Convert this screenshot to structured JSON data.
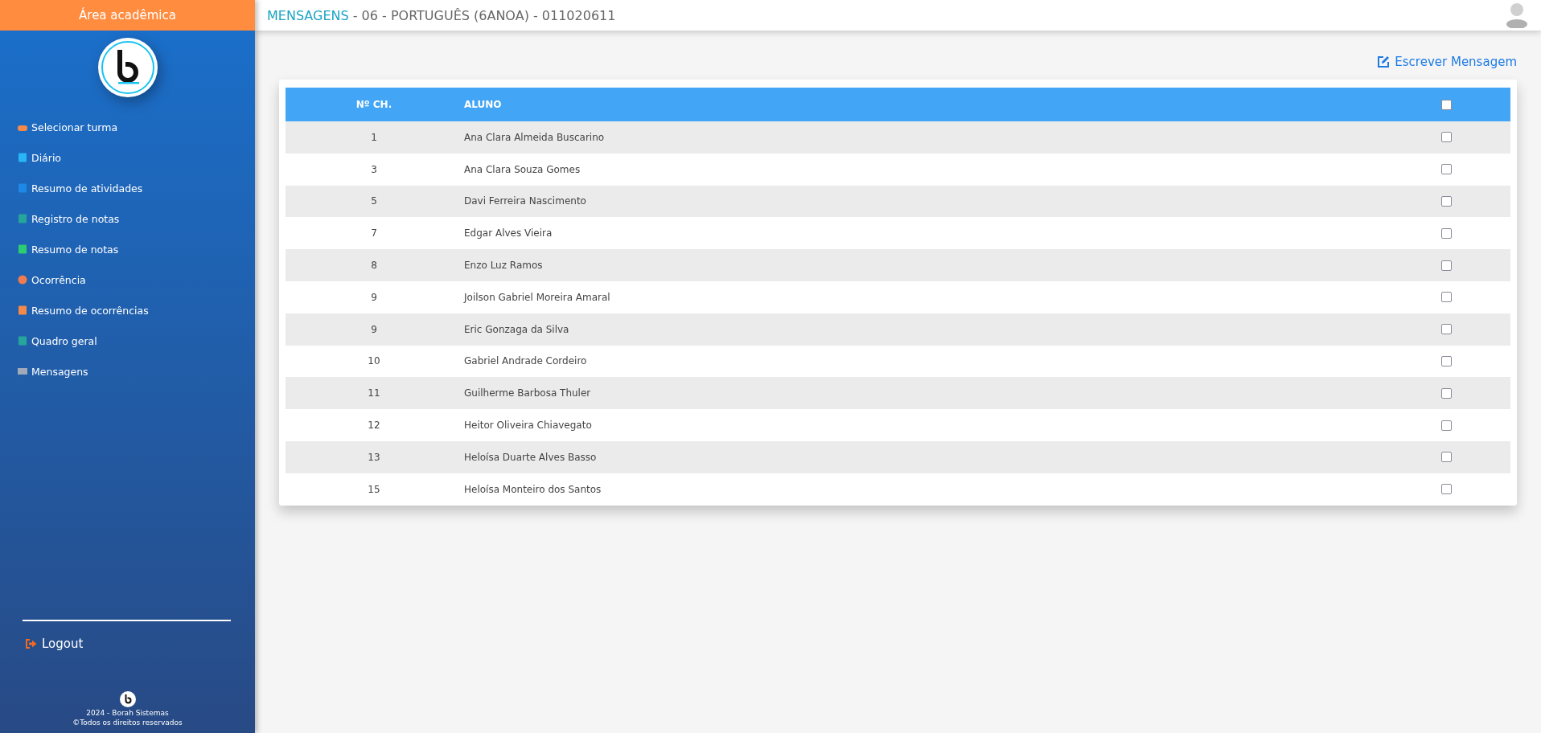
{
  "sidebar": {
    "title": "Área acadêmica",
    "items": [
      {
        "label": "Selecionar turma"
      },
      {
        "label": "Diário"
      },
      {
        "label": "Resumo de atividades"
      },
      {
        "label": "Registro de notas"
      },
      {
        "label": "Resumo de notas"
      },
      {
        "label": "Ocorrência"
      },
      {
        "label": "Resumo de ocorrências"
      },
      {
        "label": "Quadro geral"
      },
      {
        "label": "Mensagens"
      }
    ],
    "logout": "Logout",
    "footer": [
      "2024 - Borah Sistemas",
      "©Todos os direitos reservados"
    ]
  },
  "header": {
    "section": "MENSAGENS",
    "title": " - 06 - PORTUGUÊS (6ANOA) - 011020611"
  },
  "compose_link": "Escrever Mensagem",
  "table": {
    "columns": [
      "Nº CH.",
      "ALUNO"
    ],
    "select_all_checked": false,
    "rows": [
      {
        "number": "1",
        "name": "Ana Clara Almeida Buscarino",
        "checked": false
      },
      {
        "number": "3",
        "name": "Ana Clara Souza Gomes",
        "checked": false
      },
      {
        "number": "5",
        "name": "Davi Ferreira Nascimento",
        "checked": false
      },
      {
        "number": "7",
        "name": "Edgar Alves Vieira",
        "checked": false
      },
      {
        "number": "8",
        "name": "Enzo Luz Ramos",
        "checked": false
      },
      {
        "number": "9",
        "name": "Joilson Gabriel Moreira Amaral",
        "checked": false
      },
      {
        "number": "9",
        "name": "Eric Gonzaga da Silva",
        "checked": false
      },
      {
        "number": "10",
        "name": "Gabriel Andrade Cordeiro",
        "checked": false
      },
      {
        "number": "11",
        "name": "Guilherme Barbosa Thuler",
        "checked": false
      },
      {
        "number": "12",
        "name": "Heitor Oliveira Chiavegato",
        "checked": false
      },
      {
        "number": "13",
        "name": "Heloísa Duarte Alves Basso",
        "checked": false
      },
      {
        "number": "15",
        "name": "Heloísa Monteiro dos Santos",
        "checked": false
      }
    ]
  }
}
